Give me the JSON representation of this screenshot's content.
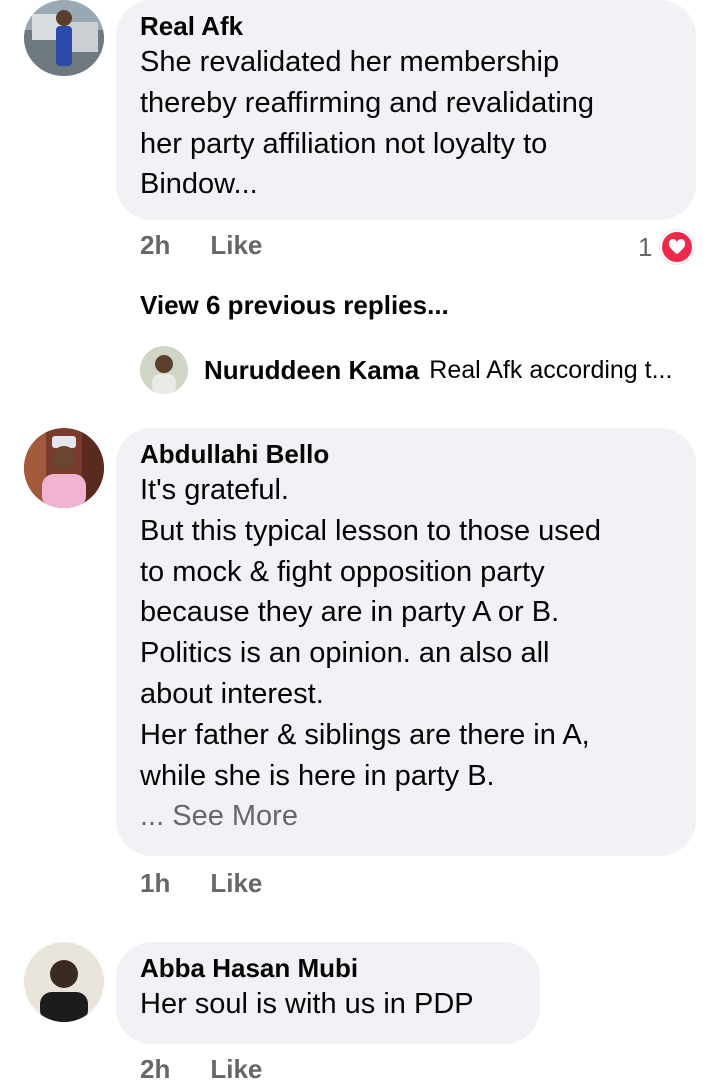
{
  "comments": [
    {
      "author": "Real Afk",
      "lines": [
        "She revalidated her membership",
        "thereby reaffirming and revalidating",
        "her party affiliation not loyalty to",
        "Bindow..."
      ],
      "time": "2h",
      "like_label": "Like",
      "reaction_count": "1",
      "reaction_icon": "heart-icon",
      "reaction_color": "#f0284a"
    },
    {
      "author": "Abdullahi Bello",
      "lines": [
        "It's grateful.",
        "But this typical lesson to those used",
        "to mock & fight opposition party",
        "because they are in party A or B.",
        "Politics is an opinion. an also all",
        "about interest.",
        "Her father & siblings are there in A,",
        "while she is here in party B."
      ],
      "see_more": "... See More",
      "time": "1h",
      "like_label": "Like"
    },
    {
      "author": "Abba Hasan Mubi",
      "lines": [
        "Her soul is with us in PDP"
      ],
      "time": "2h",
      "like_label": "Like"
    }
  ],
  "replies": {
    "view_previous": "View 6 previous replies...",
    "preview_author": "Nuruddeen Kama",
    "preview_text": "Real Afk according t..."
  },
  "colors": {
    "bubble": "#f0f2f5",
    "meta_text": "#65676b",
    "primary_text": "#050505"
  }
}
